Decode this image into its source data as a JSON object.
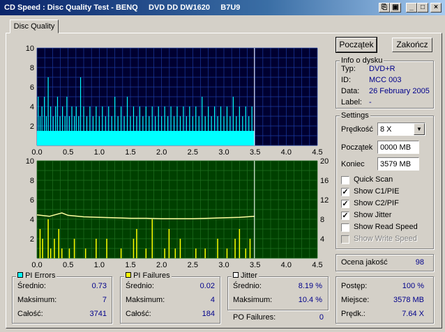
{
  "window": {
    "title": "CD Speed : Disc Quality Test - BENQ     DVD DD DW1620     B7U9"
  },
  "tabs": [
    {
      "label": "Disc Quality"
    }
  ],
  "buttons": {
    "start": "Początek",
    "end": "Zakończ"
  },
  "info": {
    "legend": "Info o dysku",
    "rows": [
      {
        "label": "Typ:",
        "value": "DVD+R"
      },
      {
        "label": "ID:",
        "value": "MCC 003"
      },
      {
        "label": "Data:",
        "value": "26 February 2005"
      },
      {
        "label": "Label:",
        "value": "-"
      }
    ]
  },
  "settings": {
    "legend": "Settings",
    "speed_label": "Prędkość",
    "speed_value": "8 X",
    "start_label": "Początek",
    "start_value": "0000 MB",
    "end_label": "Koniec",
    "end_value": "3579 MB",
    "checks": [
      {
        "label": "Quick Scan",
        "checked": false,
        "enabled": true
      },
      {
        "label": "Show C1/PIE",
        "checked": true,
        "enabled": true
      },
      {
        "label": "Show C2/PIF",
        "checked": true,
        "enabled": true
      },
      {
        "label": "Show Jitter",
        "checked": true,
        "enabled": true
      },
      {
        "label": "Show Read Speed",
        "checked": false,
        "enabled": true
      },
      {
        "label": "Show Write Speed",
        "checked": false,
        "enabled": false
      }
    ]
  },
  "quality": {
    "label": "Ocena jakość",
    "value": "98"
  },
  "progress": {
    "rows": [
      {
        "label": "Postęp:",
        "value": "100 %"
      },
      {
        "label": "Miejsce:",
        "value": "3578 MB"
      },
      {
        "label": "Prędk.:",
        "value": "7.64 X"
      }
    ]
  },
  "pi_errors": {
    "legend": "PI Errors",
    "color": "#00ffff",
    "rows": [
      {
        "label": "Średnio:",
        "value": "0.73"
      },
      {
        "label": "Maksimum:",
        "value": "7"
      },
      {
        "label": "Całość:",
        "value": "3741"
      }
    ]
  },
  "pi_failures": {
    "legend": "PI Failures",
    "color": "#ffff00",
    "rows": [
      {
        "label": "Średnio:",
        "value": "0.02"
      },
      {
        "label": "Maksimum:",
        "value": "4"
      },
      {
        "label": "Całość:",
        "value": "184"
      }
    ]
  },
  "jitter": {
    "legend": "Jitter",
    "color": "#ffffff",
    "rows": [
      {
        "label": "Średnio:",
        "value": "8.19 %"
      },
      {
        "label": "Maksimum:",
        "value": "10.4 %"
      }
    ]
  },
  "po_failures": {
    "label": "PO Failures:",
    "value": "0"
  },
  "chart_data": [
    {
      "type": "bar",
      "title": "PI Errors",
      "color": "#00ffff",
      "background": "#000030",
      "grid_color": "#1a3aa0",
      "x_ticks": [
        "0.0",
        "0.5",
        "1.0",
        "1.5",
        "2.0",
        "2.5",
        "3.0",
        "3.5",
        "4.0",
        "4.5"
      ],
      "y_ticks": [
        "2",
        "4",
        "6",
        "8",
        "10"
      ],
      "xlim": [
        0,
        4.5
      ],
      "ylim": [
        0,
        10
      ],
      "scan_end": 3.49,
      "baseline": 1.5,
      "spikes": [
        [
          0.02,
          5
        ],
        [
          0.05,
          3
        ],
        [
          0.08,
          4
        ],
        [
          0.12,
          5
        ],
        [
          0.15,
          3
        ],
        [
          0.18,
          7
        ],
        [
          0.22,
          4
        ],
        [
          0.26,
          3
        ],
        [
          0.3,
          4
        ],
        [
          0.33,
          5
        ],
        [
          0.37,
          3
        ],
        [
          0.41,
          4
        ],
        [
          0.45,
          3
        ],
        [
          0.48,
          5
        ],
        [
          0.52,
          3
        ],
        [
          0.56,
          4
        ],
        [
          0.6,
          3
        ],
        [
          0.63,
          4
        ],
        [
          0.67,
          3
        ],
        [
          0.7,
          7
        ],
        [
          0.75,
          4
        ],
        [
          0.8,
          3
        ],
        [
          0.85,
          4
        ],
        [
          0.9,
          3
        ],
        [
          0.95,
          4
        ],
        [
          1.0,
          3
        ],
        [
          1.05,
          4
        ],
        [
          1.1,
          3
        ],
        [
          1.15,
          4
        ],
        [
          1.2,
          3
        ],
        [
          1.25,
          5
        ],
        [
          1.3,
          3
        ],
        [
          1.35,
          4
        ],
        [
          1.4,
          3
        ],
        [
          1.45,
          5
        ],
        [
          1.5,
          3
        ],
        [
          1.55,
          4
        ],
        [
          1.6,
          3
        ],
        [
          1.65,
          4
        ],
        [
          1.7,
          3
        ],
        [
          1.75,
          4
        ],
        [
          1.8,
          3
        ],
        [
          1.85,
          4
        ],
        [
          1.9,
          3
        ],
        [
          1.95,
          4
        ],
        [
          2.0,
          3
        ],
        [
          2.05,
          4
        ],
        [
          2.1,
          3
        ],
        [
          2.15,
          4
        ],
        [
          2.2,
          3
        ],
        [
          2.25,
          4
        ],
        [
          2.3,
          3
        ],
        [
          2.35,
          4
        ],
        [
          2.4,
          3
        ],
        [
          2.45,
          4
        ],
        [
          2.5,
          3
        ],
        [
          2.55,
          4
        ],
        [
          2.6,
          3
        ],
        [
          2.65,
          5
        ],
        [
          2.7,
          3
        ],
        [
          2.75,
          4
        ],
        [
          2.8,
          3
        ],
        [
          2.85,
          4
        ],
        [
          2.9,
          3
        ],
        [
          2.95,
          4
        ],
        [
          3.0,
          3
        ],
        [
          3.05,
          4
        ],
        [
          3.1,
          3
        ],
        [
          3.15,
          5
        ],
        [
          3.2,
          3
        ],
        [
          3.25,
          4
        ],
        [
          3.3,
          3
        ],
        [
          3.35,
          4
        ],
        [
          3.4,
          3
        ],
        [
          3.45,
          4
        ]
      ]
    },
    {
      "type": "bar+line",
      "title": "PI Failures / Jitter",
      "bar_color": "#ffff00",
      "line_color": "#ffffa0",
      "background": "#004000",
      "grid_color": "#207020",
      "x_ticks": [
        "0.0",
        "0.5",
        "1.0",
        "1.5",
        "2.0",
        "2.5",
        "3.0",
        "3.5",
        "4.0",
        "4.5"
      ],
      "y_ticks_left": [
        "2",
        "4",
        "6",
        "8",
        "10"
      ],
      "y_ticks_right": [
        "4",
        "8",
        "12",
        "16",
        "20"
      ],
      "xlim": [
        0,
        4.5
      ],
      "ylim_left": [
        0,
        10
      ],
      "ylim_right": [
        0,
        20
      ],
      "scan_end": 3.49,
      "failures": [
        [
          0.05,
          3
        ],
        [
          0.09,
          2
        ],
        [
          0.18,
          4
        ],
        [
          0.22,
          1
        ],
        [
          0.28,
          2
        ],
        [
          0.35,
          3
        ],
        [
          0.4,
          1
        ],
        [
          0.52,
          1
        ],
        [
          0.6,
          2
        ],
        [
          0.78,
          1
        ],
        [
          0.95,
          2
        ],
        [
          1.12,
          2
        ],
        [
          1.35,
          1
        ],
        [
          1.55,
          2
        ],
        [
          1.6,
          3
        ],
        [
          1.75,
          1
        ],
        [
          1.85,
          4
        ],
        [
          2.05,
          1
        ],
        [
          2.12,
          3
        ],
        [
          2.22,
          1
        ],
        [
          2.3,
          2
        ],
        [
          2.55,
          1
        ],
        [
          2.7,
          1
        ],
        [
          2.9,
          2
        ],
        [
          3.05,
          1
        ],
        [
          3.18,
          2
        ],
        [
          3.25,
          3
        ],
        [
          3.35,
          1
        ],
        [
          3.42,
          2
        ]
      ],
      "jitter": [
        [
          0.0,
          8.9
        ],
        [
          0.2,
          8.6
        ],
        [
          0.4,
          9.3
        ],
        [
          0.5,
          8.8
        ],
        [
          0.75,
          8.5
        ],
        [
          1.0,
          8.4
        ],
        [
          1.25,
          8.3
        ],
        [
          1.5,
          8.2
        ],
        [
          1.75,
          8.2
        ],
        [
          2.0,
          8.1
        ],
        [
          2.25,
          8.1
        ],
        [
          2.5,
          8.1
        ],
        [
          2.75,
          8.2
        ],
        [
          3.0,
          8.3
        ],
        [
          3.25,
          8.4
        ],
        [
          3.49,
          8.6
        ]
      ]
    }
  ]
}
